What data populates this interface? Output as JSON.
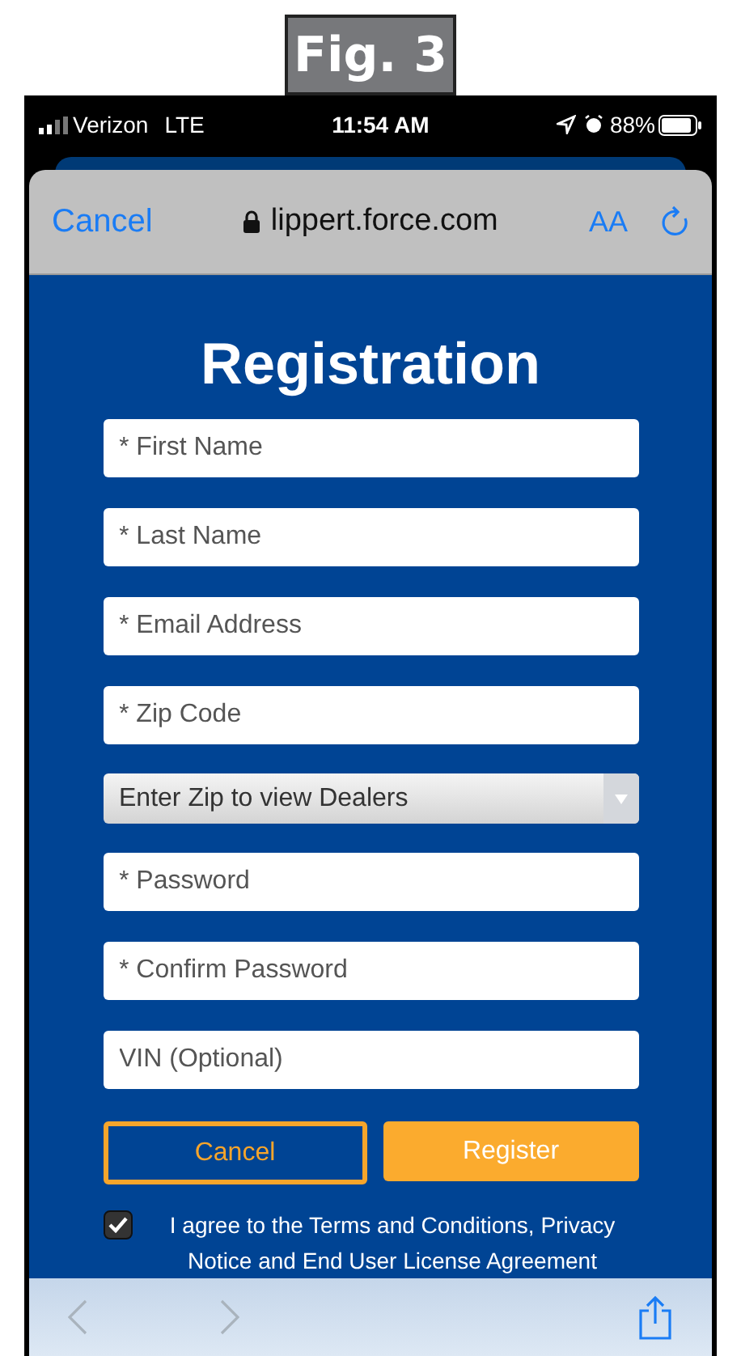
{
  "figure_label": "Fig. 3",
  "status_bar": {
    "carrier": "Verizon",
    "network": "LTE",
    "time": "11:54 AM",
    "battery": "88%"
  },
  "browser_header": {
    "cancel": "Cancel",
    "url": "lippert.force.com",
    "text_size": "AA"
  },
  "form": {
    "title": "Registration",
    "fields": [
      {
        "kind": "input",
        "placeholder": "* First Name"
      },
      {
        "kind": "input",
        "placeholder": "* Last Name"
      },
      {
        "kind": "input",
        "placeholder": "* Email Address"
      },
      {
        "kind": "input",
        "placeholder": "* Zip Code"
      },
      {
        "kind": "select",
        "value": "Enter Zip to view Dealers"
      },
      {
        "kind": "input",
        "placeholder": "* Password"
      },
      {
        "kind": "input",
        "placeholder": "* Confirm Password"
      },
      {
        "kind": "input",
        "placeholder": "VIN (Optional)"
      }
    ],
    "buttons": [
      {
        "kind": "outline",
        "label": "Cancel"
      },
      {
        "kind": "filled",
        "label": "Register"
      }
    ],
    "agreement": {
      "checked": true,
      "text": "I agree to the Terms and Conditions, Privacy Notice and End User License Agreement"
    }
  },
  "toolbar": {
    "back_disabled": true,
    "forward_disabled": true
  }
}
